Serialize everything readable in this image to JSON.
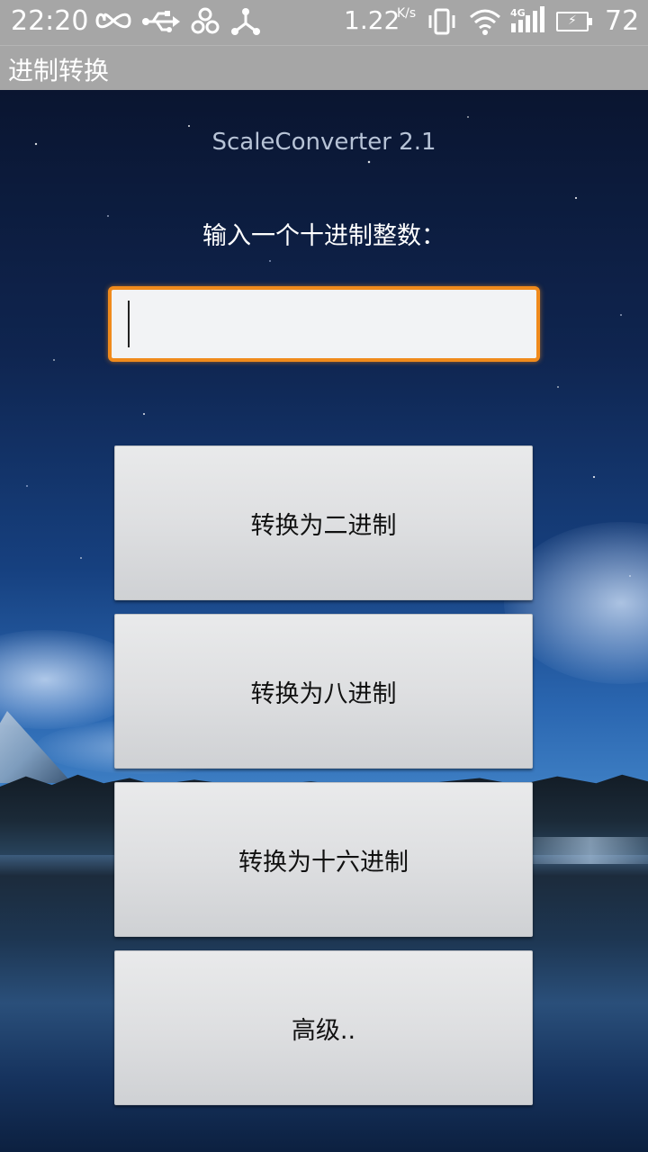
{
  "status_bar": {
    "time": "22:20",
    "speed_value": "1.22",
    "speed_unit": "K/s",
    "network_type": "4G",
    "battery_percent": "72",
    "icons": [
      "infinity-icon",
      "usb-icon",
      "link-icon",
      "share-icon",
      "vibrate-icon",
      "wifi-icon",
      "signal-icon",
      "battery-charging-icon"
    ]
  },
  "action_bar": {
    "title": "进制转换"
  },
  "main": {
    "app_version": "ScaleConverter 2.1",
    "prompt": "输入一个十进制整数：",
    "input": {
      "value": "",
      "placeholder": ""
    },
    "buttons": {
      "to_binary": "转换为二进制",
      "to_octal": "转换为八进制",
      "to_hex": "转换为十六进制",
      "advanced": "高级.."
    }
  },
  "colors": {
    "status_bar_bg": "#a6a6a6",
    "input_focus_border": "#f08a1c",
    "button_bg": "#dedfe1",
    "battery_fill": "#22c322"
  }
}
